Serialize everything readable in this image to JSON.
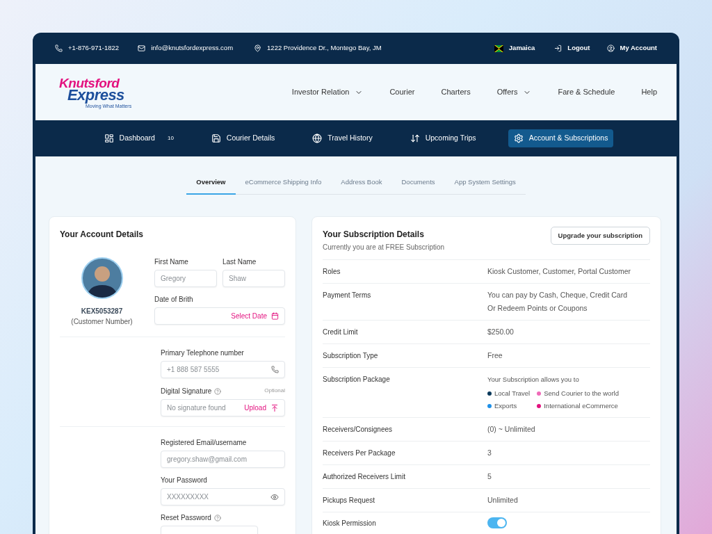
{
  "contact_bar": {
    "phone": "+1-876-971-1822",
    "email": "info@knutsfordexpress.com",
    "address": "1222 Providence Dr., Montego Bay, JM",
    "country": "Jamaica",
    "logout": "Logout",
    "account": "My Account"
  },
  "logo": {
    "line1": "Knutsford",
    "line2": "Express",
    "tagline": "Moving What Matters"
  },
  "main_nav": [
    {
      "label": "Investor Relation",
      "dropdown": true
    },
    {
      "label": "Courier",
      "dropdown": false
    },
    {
      "label": "Charters",
      "dropdown": false
    },
    {
      "label": "Offers",
      "dropdown": true
    },
    {
      "label": "Fare & Schedule",
      "dropdown": false
    },
    {
      "label": "Help",
      "dropdown": false
    }
  ],
  "section_nav": [
    {
      "label": "Dashboard",
      "badge": "10",
      "selected": false
    },
    {
      "label": "Courier Details",
      "selected": false
    },
    {
      "label": "Travel History",
      "selected": false
    },
    {
      "label": "Upcoming Trips",
      "selected": false
    },
    {
      "label": "Account & Subscriptions",
      "selected": true
    }
  ],
  "tabs": [
    {
      "label": "Overview",
      "selected": true
    },
    {
      "label": "eCommerce Shipping Info",
      "selected": false
    },
    {
      "label": "Address Book",
      "selected": false
    },
    {
      "label": "Documents",
      "selected": false
    },
    {
      "label": "App System Settings",
      "selected": false
    }
  ],
  "account_card": {
    "title": "Your Account Details",
    "customer_number": "KEX5053287",
    "customer_number_caption": "(Customer Number)",
    "first_name": {
      "label": "First Name",
      "value": "Gregory"
    },
    "last_name": {
      "label": "Last Name",
      "value": "Shaw"
    },
    "date_of_birth": {
      "label": "Date of Brith",
      "action": "Select Date"
    },
    "telephone": {
      "label": "Primary Telephone number",
      "value": "+1 888 587 5555"
    },
    "signature": {
      "label": "Digital Signature",
      "note": "Optional",
      "value": "No signature found",
      "action": "Upload"
    },
    "email": {
      "label": "Registered Email/username",
      "value": "gregory.shaw@gmail.com"
    },
    "password": {
      "label": "Your Password",
      "value": "XXXXXXXXX"
    },
    "reset_password": {
      "label": "Reset Password"
    }
  },
  "subscription_card": {
    "title": "Your Subscription Details",
    "subtitle": "Currently you are at FREE Subscription",
    "upgrade_button": "Upgrade your subscription",
    "rows": [
      {
        "kind": "text",
        "label": "Roles",
        "value": "Kiosk Customer, Customer, Portal Customer"
      },
      {
        "kind": "lines",
        "label": "Payment Terms",
        "lines": [
          "You can pay by Cash, Cheque, Credit Card",
          "Or Redeem Points or Coupons"
        ]
      },
      {
        "kind": "text",
        "label": "Credit Limit",
        "value": "$250.00"
      },
      {
        "kind": "text",
        "label": "Subscription Type",
        "value": "Free"
      },
      {
        "kind": "package",
        "label": "Subscription Package",
        "intro": "Your Subscription allows you to",
        "features": [
          {
            "label": "Local Travel",
            "color": "#0b3a5c"
          },
          {
            "label": "Send Courier to the world",
            "color": "#f06ab8"
          },
          {
            "label": "Exports",
            "color": "#1e90e8"
          },
          {
            "label": "International eCommerce",
            "color": "#e3117f"
          }
        ]
      },
      {
        "kind": "text",
        "label": "Receivers/Consignees",
        "value": "(0) ~ Unlimited"
      },
      {
        "kind": "text",
        "label": "Receivers Per Package",
        "value": "3"
      },
      {
        "kind": "text",
        "label": "Authorized Receivers Limit",
        "value": "5"
      },
      {
        "kind": "text",
        "label": "Pickups Request",
        "value": "Unlimited"
      },
      {
        "kind": "toggle",
        "label": "Kiosk Permission",
        "on": true
      }
    ]
  }
}
